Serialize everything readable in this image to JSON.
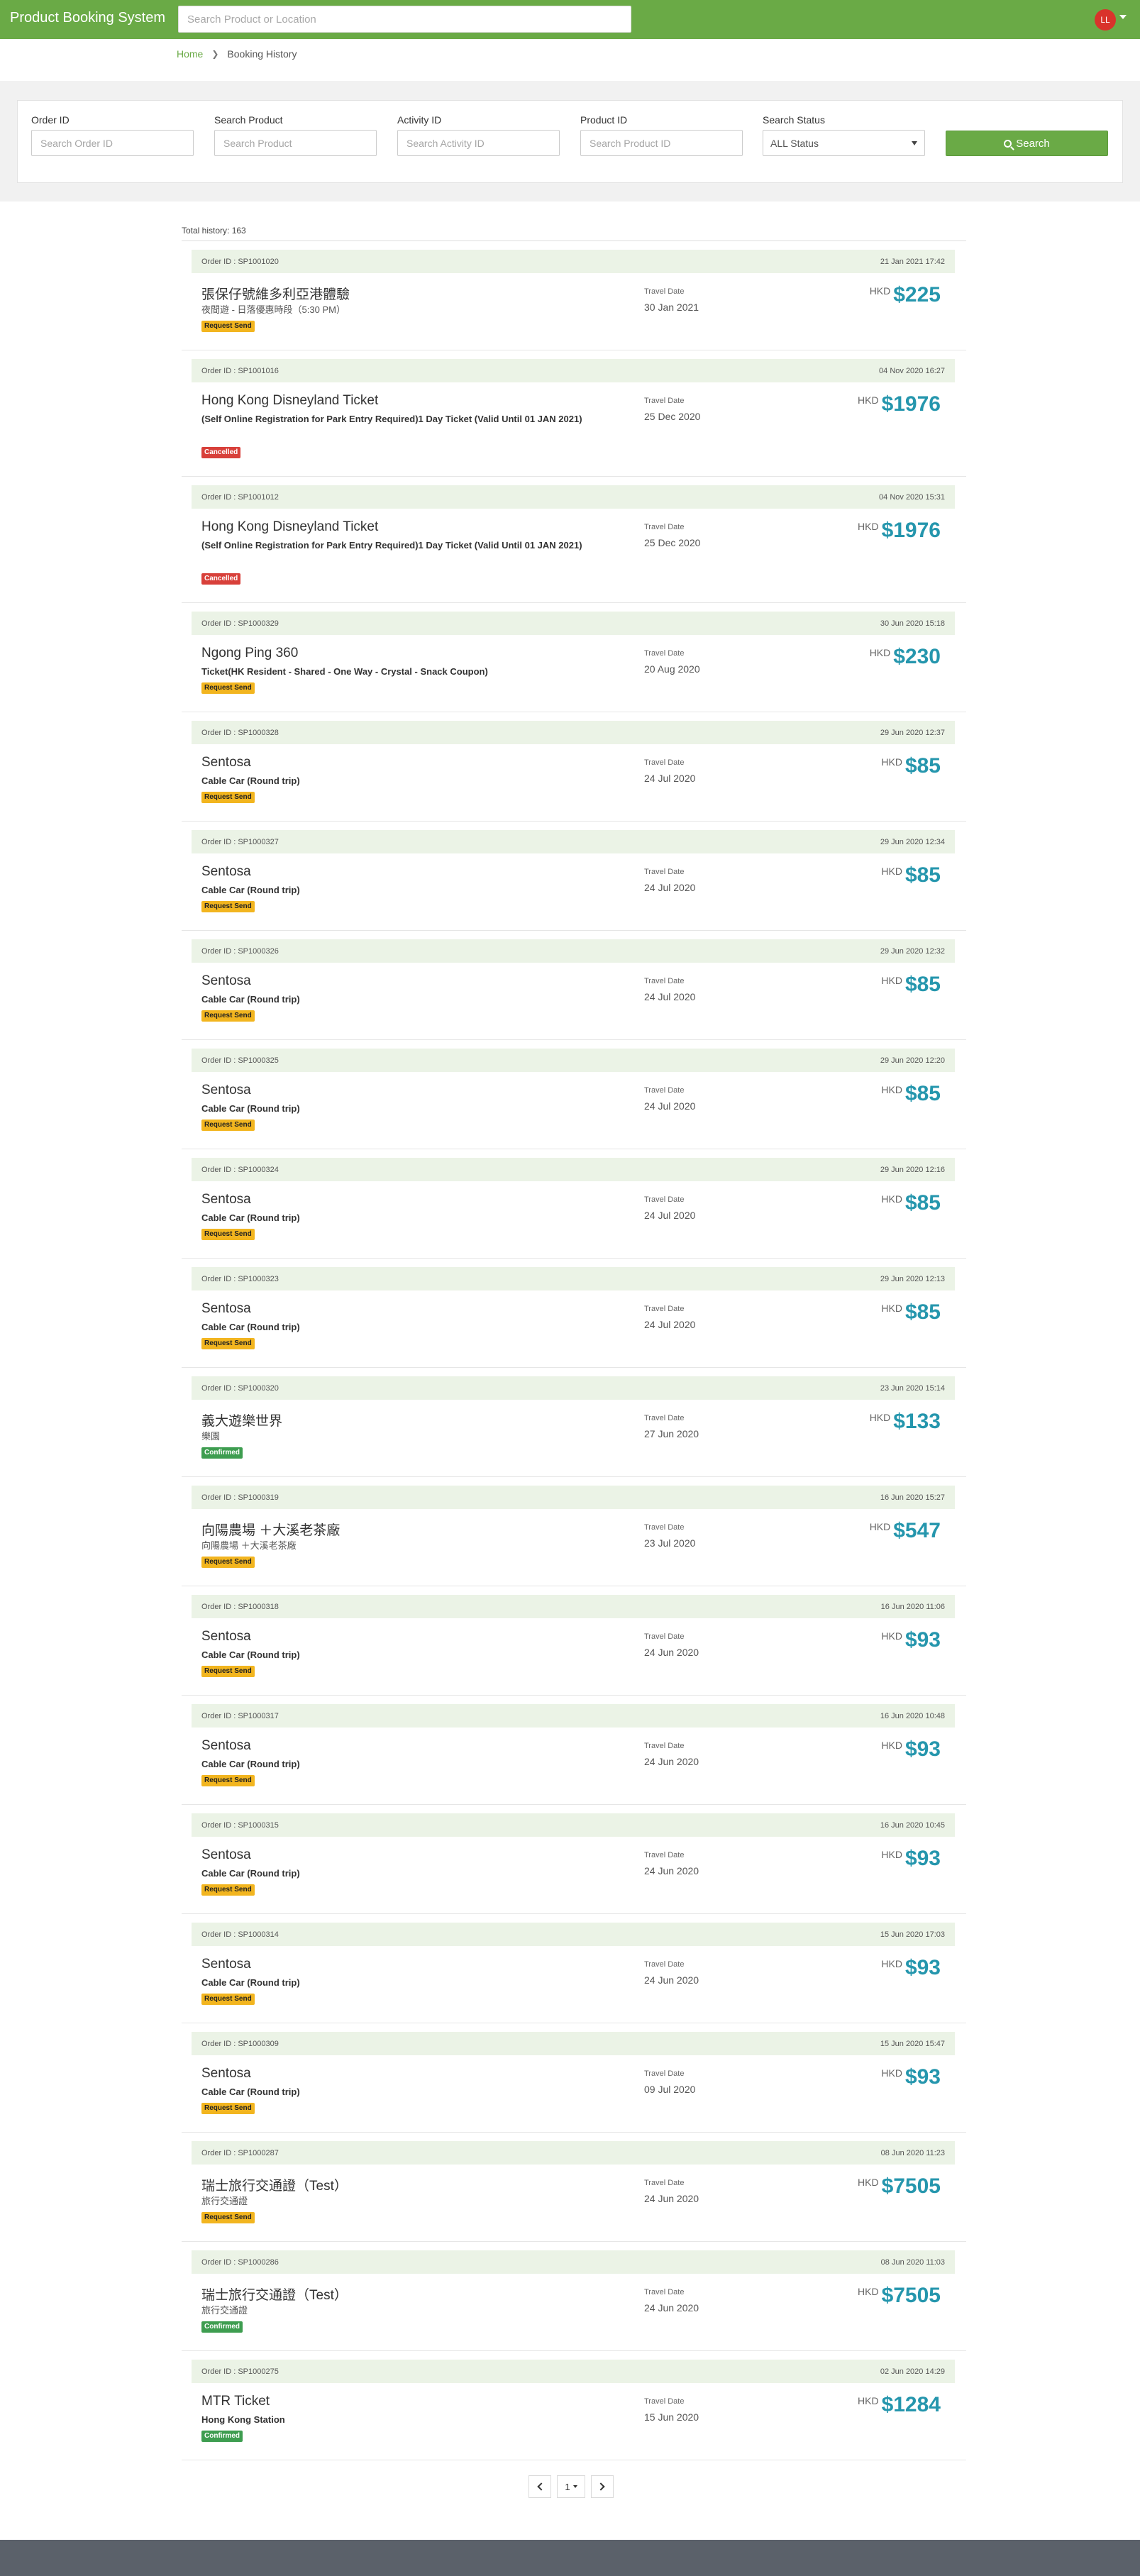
{
  "header": {
    "brand": "Product Booking System",
    "search_placeholder": "Search Product or Location",
    "avatar_initials": "LL"
  },
  "breadcrumb": {
    "home": "Home",
    "current": "Booking History"
  },
  "filters": {
    "order_id": {
      "label": "Order ID",
      "placeholder": "Search Order ID"
    },
    "product": {
      "label": "Search Product",
      "placeholder": "Search Product"
    },
    "activity_id": {
      "label": "Activity ID",
      "placeholder": "Search Activity ID"
    },
    "product_id": {
      "label": "Product ID",
      "placeholder": "Search Product ID"
    },
    "status": {
      "label": "Search Status",
      "selected": "ALL Status"
    },
    "search_button": "Search"
  },
  "total": "Total history: 163",
  "labels": {
    "order_prefix": "Order ID : ",
    "travel_date": "Travel Date",
    "currency": "HKD"
  },
  "orders": [
    {
      "id": "SP1001020",
      "created": "21 Jan 2021 17:42",
      "name": "張保仔號維多利亞港體驗",
      "sub": "夜間遊 - 日落優惠時段（5:30 PM）",
      "sub_bold": false,
      "status": "Request Send",
      "status_type": "request",
      "travel_date": "30 Jan 2021",
      "price": "$225",
      "tall": false
    },
    {
      "id": "SP1001016",
      "created": "04 Nov 2020 16:27",
      "name": "Hong Kong Disneyland Ticket",
      "sub": "(Self Online Registration for Park Entry Required)1 Day Ticket (Valid Until 01 JAN 2021)",
      "sub_bold": true,
      "status": "Cancelled",
      "status_type": "cancel",
      "travel_date": "25 Dec 2020",
      "price": "$1976",
      "tall": true
    },
    {
      "id": "SP1001012",
      "created": "04 Nov 2020 15:31",
      "name": "Hong Kong Disneyland Ticket",
      "sub": "(Self Online Registration for Park Entry Required)1 Day Ticket (Valid Until 01 JAN 2021)",
      "sub_bold": true,
      "status": "Cancelled",
      "status_type": "cancel",
      "travel_date": "25 Dec 2020",
      "price": "$1976",
      "tall": true
    },
    {
      "id": "SP1000329",
      "created": "30 Jun 2020 15:18",
      "name": "Ngong Ping 360",
      "sub": "Ticket(HK Resident - Shared - One Way - Crystal - Snack Coupon)",
      "sub_bold": true,
      "status": "Request Send",
      "status_type": "request",
      "travel_date": "20 Aug 2020",
      "price": "$230",
      "tall": false
    },
    {
      "id": "SP1000328",
      "created": "29 Jun 2020 12:37",
      "name": "Sentosa",
      "sub": "Cable Car (Round trip)",
      "sub_bold": true,
      "status": "Request Send",
      "status_type": "request",
      "travel_date": "24 Jul 2020",
      "price": "$85",
      "tall": false
    },
    {
      "id": "SP1000327",
      "created": "29 Jun 2020 12:34",
      "name": "Sentosa",
      "sub": "Cable Car (Round trip)",
      "sub_bold": true,
      "status": "Request Send",
      "status_type": "request",
      "travel_date": "24 Jul 2020",
      "price": "$85",
      "tall": false
    },
    {
      "id": "SP1000326",
      "created": "29 Jun 2020 12:32",
      "name": "Sentosa",
      "sub": "Cable Car (Round trip)",
      "sub_bold": true,
      "status": "Request Send",
      "status_type": "request",
      "travel_date": "24 Jul 2020",
      "price": "$85",
      "tall": false
    },
    {
      "id": "SP1000325",
      "created": "29 Jun 2020 12:20",
      "name": "Sentosa",
      "sub": "Cable Car (Round trip)",
      "sub_bold": true,
      "status": "Request Send",
      "status_type": "request",
      "travel_date": "24 Jul 2020",
      "price": "$85",
      "tall": false
    },
    {
      "id": "SP1000324",
      "created": "29 Jun 2020 12:16",
      "name": "Sentosa",
      "sub": "Cable Car (Round trip)",
      "sub_bold": true,
      "status": "Request Send",
      "status_type": "request",
      "travel_date": "24 Jul 2020",
      "price": "$85",
      "tall": false
    },
    {
      "id": "SP1000323",
      "created": "29 Jun 2020 12:13",
      "name": "Sentosa",
      "sub": "Cable Car (Round trip)",
      "sub_bold": true,
      "status": "Request Send",
      "status_type": "request",
      "travel_date": "24 Jul 2020",
      "price": "$85",
      "tall": false
    },
    {
      "id": "SP1000320",
      "created": "23 Jun 2020 15:14",
      "name": "義大遊樂世界",
      "sub": "樂園",
      "sub_bold": false,
      "status": "Confirmed",
      "status_type": "confirm",
      "travel_date": "27 Jun 2020",
      "price": "$133",
      "tall": false
    },
    {
      "id": "SP1000319",
      "created": "16 Jun 2020 15:27",
      "name": "向陽農場 ＋大溪老茶廠",
      "sub": "向陽農場 ＋大溪老茶廠",
      "sub_bold": false,
      "status": "Request Send",
      "status_type": "request",
      "travel_date": "23 Jul 2020",
      "price": "$547",
      "tall": false
    },
    {
      "id": "SP1000318",
      "created": "16 Jun 2020 11:06",
      "name": "Sentosa",
      "sub": "Cable Car (Round trip)",
      "sub_bold": true,
      "status": "Request Send",
      "status_type": "request",
      "travel_date": "24 Jun 2020",
      "price": "$93",
      "tall": false
    },
    {
      "id": "SP1000317",
      "created": "16 Jun 2020 10:48",
      "name": "Sentosa",
      "sub": "Cable Car (Round trip)",
      "sub_bold": true,
      "status": "Request Send",
      "status_type": "request",
      "travel_date": "24 Jun 2020",
      "price": "$93",
      "tall": false
    },
    {
      "id": "SP1000315",
      "created": "16 Jun 2020 10:45",
      "name": "Sentosa",
      "sub": "Cable Car (Round trip)",
      "sub_bold": true,
      "status": "Request Send",
      "status_type": "request",
      "travel_date": "24 Jun 2020",
      "price": "$93",
      "tall": false
    },
    {
      "id": "SP1000314",
      "created": "15 Jun 2020 17:03",
      "name": "Sentosa",
      "sub": "Cable Car (Round trip)",
      "sub_bold": true,
      "status": "Request Send",
      "status_type": "request",
      "travel_date": "24 Jun 2020",
      "price": "$93",
      "tall": false
    },
    {
      "id": "SP1000309",
      "created": "15 Jun 2020 15:47",
      "name": "Sentosa",
      "sub": "Cable Car (Round trip)",
      "sub_bold": true,
      "status": "Request Send",
      "status_type": "request",
      "travel_date": "09 Jul 2020",
      "price": "$93",
      "tall": false
    },
    {
      "id": "SP1000287",
      "created": "08 Jun 2020 11:23",
      "name": "瑞士旅行交通證（Test）",
      "sub": "旅行交通證",
      "sub_bold": false,
      "status": "Request Send",
      "status_type": "request",
      "travel_date": "24 Jun 2020",
      "price": "$7505",
      "tall": false
    },
    {
      "id": "SP1000286",
      "created": "08 Jun 2020 11:03",
      "name": "瑞士旅行交通證（Test）",
      "sub": "旅行交通證",
      "sub_bold": false,
      "status": "Confirmed",
      "status_type": "confirm",
      "travel_date": "24 Jun 2020",
      "price": "$7505",
      "tall": false
    },
    {
      "id": "SP1000275",
      "created": "02 Jun 2020 14:29",
      "name": "MTR Ticket",
      "sub": "Hong Kong Station",
      "sub_bold": true,
      "status": "Confirmed",
      "status_type": "confirm",
      "travel_date": "15 Jun 2020",
      "price": "$1284",
      "tall": false
    }
  ],
  "pagination": {
    "current_page": "1"
  },
  "colors": {
    "brand_green": "#6aaa46",
    "price_blue": "#2596ad",
    "request": "#f2b51f",
    "cancelled": "#d8403a",
    "confirmed": "#3e9d50",
    "footer": "#5b616a"
  },
  "icons": {
    "search": "magnifier-icon",
    "prev": "chevron-left-icon",
    "next": "chevron-right-icon",
    "caret": "caret-down-icon",
    "crumb_sep": "chevron-right-icon"
  }
}
